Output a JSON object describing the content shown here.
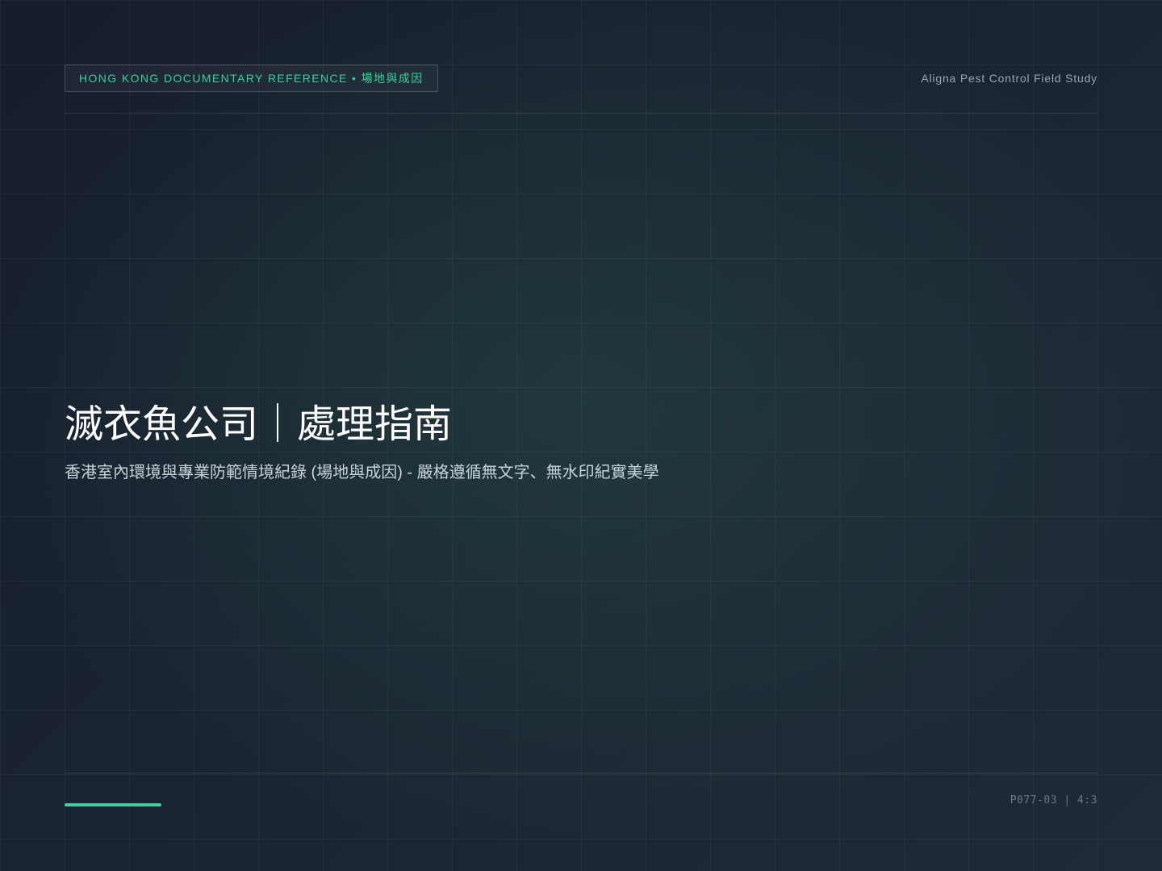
{
  "header": {
    "tag": "HONG KONG DOCUMENTARY REFERENCE • 場地與成因",
    "study": "Aligna Pest Control Field Study"
  },
  "hero": {
    "title": "滅衣魚公司｜處理指南",
    "subtitle": "香港室內環境與專業防範情境紀錄 (場地與成因) - 嚴格遵循無文字、無水印紀實美學"
  },
  "footer": {
    "page_code": "P077-03 | 4:3"
  },
  "colors": {
    "accent": "#34d399",
    "background": "#1b2532",
    "muted_text": "#9aa3b2"
  }
}
